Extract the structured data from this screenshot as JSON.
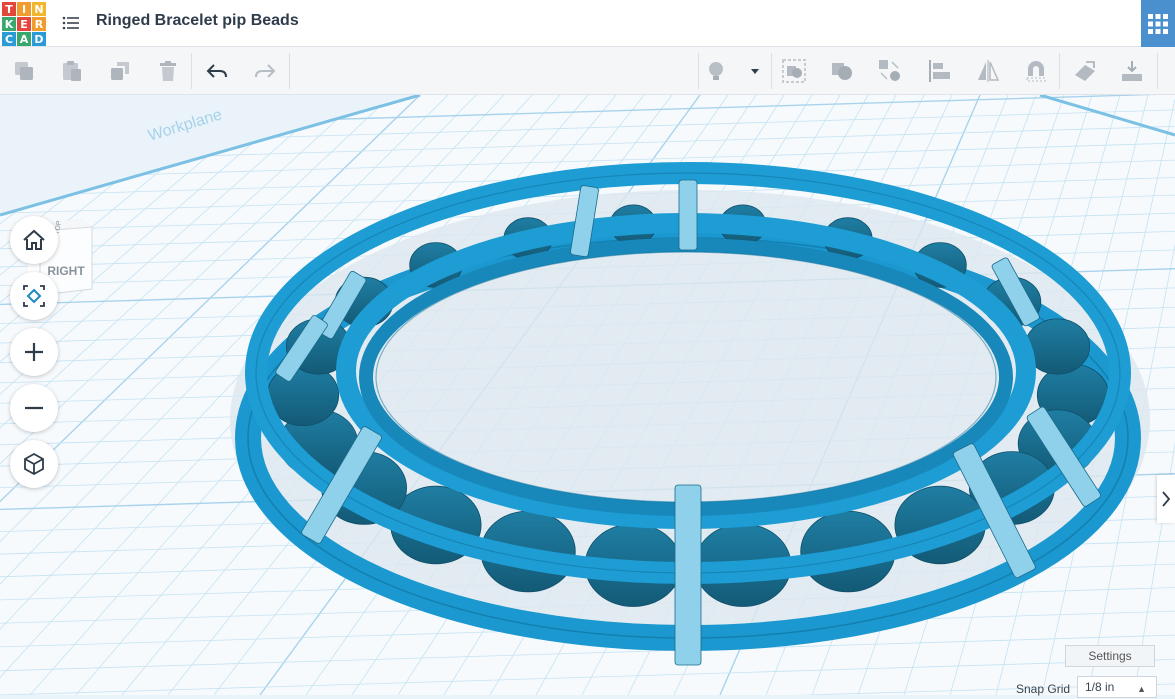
{
  "app": {
    "logo_letters": [
      "T",
      "I",
      "N",
      "K",
      "E",
      "R",
      "C",
      "A",
      "D"
    ],
    "logo_colors": [
      "#e2473b",
      "#f09d2e",
      "#f2b52e",
      "#38a86d",
      "#e2473b",
      "#f09d2e",
      "#2a9bd8",
      "#38a86d",
      "#2a9bd8"
    ],
    "title": "Ringed Bracelet pip Beads"
  },
  "header": {
    "menu_icon": "list-icon",
    "apps_icon": "grid-apps-icon",
    "apps_color": "#4a90cf"
  },
  "toolbar": {
    "left_tools": [
      "copy-icon",
      "paste-icon",
      "duplicate-icon",
      "delete-icon",
      "undo-icon",
      "redo-icon"
    ],
    "right_tools": [
      "light-bulb-icon",
      "dropdown-caret-icon",
      "group-icon",
      "ungroup-icon",
      "align-icon",
      "flip-icon",
      "mirror-icon",
      "magnet-icon",
      "workplane-icon",
      "ruler-icon"
    ]
  },
  "workplane": {
    "grid_color": "#c6e2f3",
    "ring_color": "#1a98cf",
    "bead_color": "#1a6a8a",
    "clip_color": "#8fd0ea",
    "workplane_label": "Workplane"
  },
  "viewcube": {
    "face_label": "RIGHT",
    "top_label": "TOP"
  },
  "nav": [
    "home-view",
    "fit-view",
    "zoom-in",
    "zoom-out",
    "perspective-toggle"
  ],
  "footer": {
    "settings_label": "Settings",
    "snap_grid_label": "Snap Grid",
    "snap_grid_value": "1/8 in"
  }
}
